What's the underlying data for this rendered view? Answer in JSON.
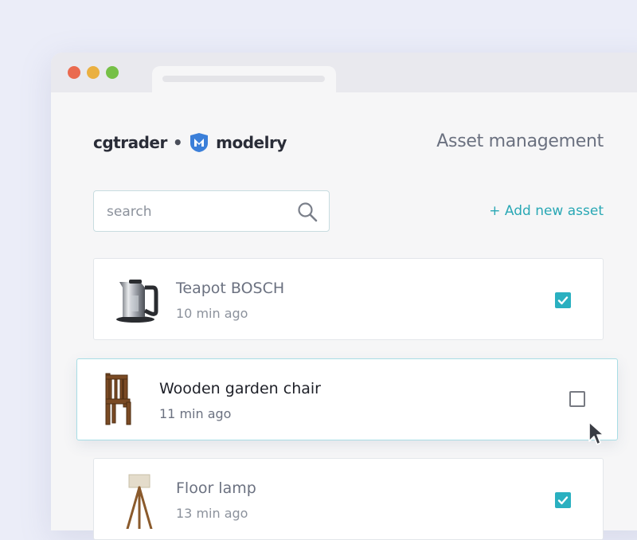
{
  "window": {
    "controls": [
      "close",
      "minimize",
      "maximize"
    ]
  },
  "brand": {
    "primary": "cgtrader",
    "separator": "•",
    "secondary": "modelry",
    "logo_icon": "shield-m-icon",
    "accent": "#2aa8b5"
  },
  "page_title": "Asset management",
  "search": {
    "placeholder": "search",
    "value": "",
    "icon": "search-icon"
  },
  "add_asset_label": "+ Add new asset",
  "assets": [
    {
      "name": "Teapot BOSCH",
      "time": "10 min ago",
      "checked": true,
      "icon": "kettle-icon"
    },
    {
      "name": "Wooden garden chair",
      "time": "11 min ago",
      "checked": false,
      "hovered": true,
      "icon": "chair-icon"
    },
    {
      "name": "Floor lamp",
      "time": "13 min ago",
      "checked": true,
      "icon": "floor-lamp-icon"
    }
  ],
  "colors": {
    "checkbox_checked": "#2ab0c0",
    "link": "#2aa8b5",
    "hover_border": "#a7dde5"
  }
}
